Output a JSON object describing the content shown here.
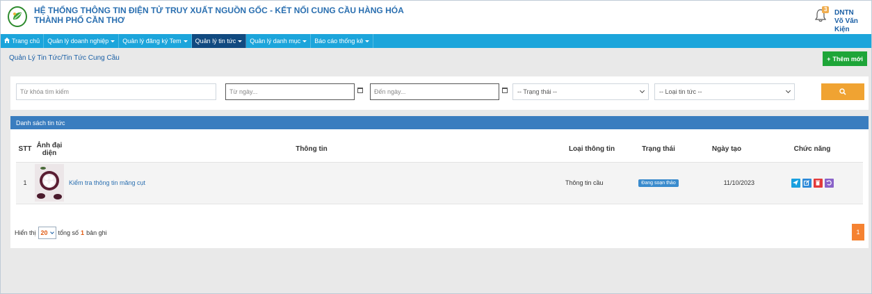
{
  "header": {
    "title_line1": "HỆ THỐNG THÔNG TIN ĐIỆN TỬ TRUY XUẤT NGUỒN GỐC - KẾT NỐI CUNG CẦU HÀNG HÓA",
    "title_line2": "THÀNH PHỐ CẦN THƠ",
    "notification_count": "3",
    "user_role": "DNTN",
    "user_name": "Võ Văn Kiện"
  },
  "nav": {
    "items": [
      {
        "label": "Trang chủ",
        "icon": "home-icon"
      },
      {
        "label": "Quản lý doanh nghiệp"
      },
      {
        "label": "Quản lý đăng ký Tem"
      },
      {
        "label": "Quản lý tin tức"
      },
      {
        "label": "Quản lý danh mục"
      },
      {
        "label": "Báo cáo thống kê"
      }
    ]
  },
  "page": {
    "title": "Quản Lý Tin Tức/Tin Tức Cung Cầu",
    "add_label": "Thêm mới"
  },
  "filter": {
    "keyword_placeholder": "Từ khóa tìm kiếm",
    "from_date_placeholder": "Từ ngày...",
    "to_date_placeholder": "Đến ngày...",
    "status_selected": "-- Trạng thái --",
    "type_selected": "-- Loại tin tức --"
  },
  "panel": {
    "title": "Danh sách tin tức",
    "columns": [
      "STT",
      "Ảnh đại diện",
      "Thông tin",
      "Loại thông tin",
      "Trạng thái",
      "Ngày tạo",
      "Chức năng"
    ],
    "rows": [
      {
        "stt": "1",
        "info": "Kiểm tra thông tin măng cụt",
        "type": "Thông tin cầu",
        "status": "Đang soạn thảo",
        "date": "11/10/2023"
      }
    ]
  },
  "pager": {
    "show_label": "Hiển thị",
    "page_size": "20",
    "total_prefix": "tổng số",
    "total": "1",
    "total_suffix": "bản ghi",
    "current_page": "1"
  },
  "colors": {
    "nav_bg": "#1ca5db",
    "nav_active": "#114a80",
    "panel_head": "#3a7dbf",
    "add_button": "#1ea538",
    "search_button": "#f0a332",
    "page_active": "#f58231"
  }
}
